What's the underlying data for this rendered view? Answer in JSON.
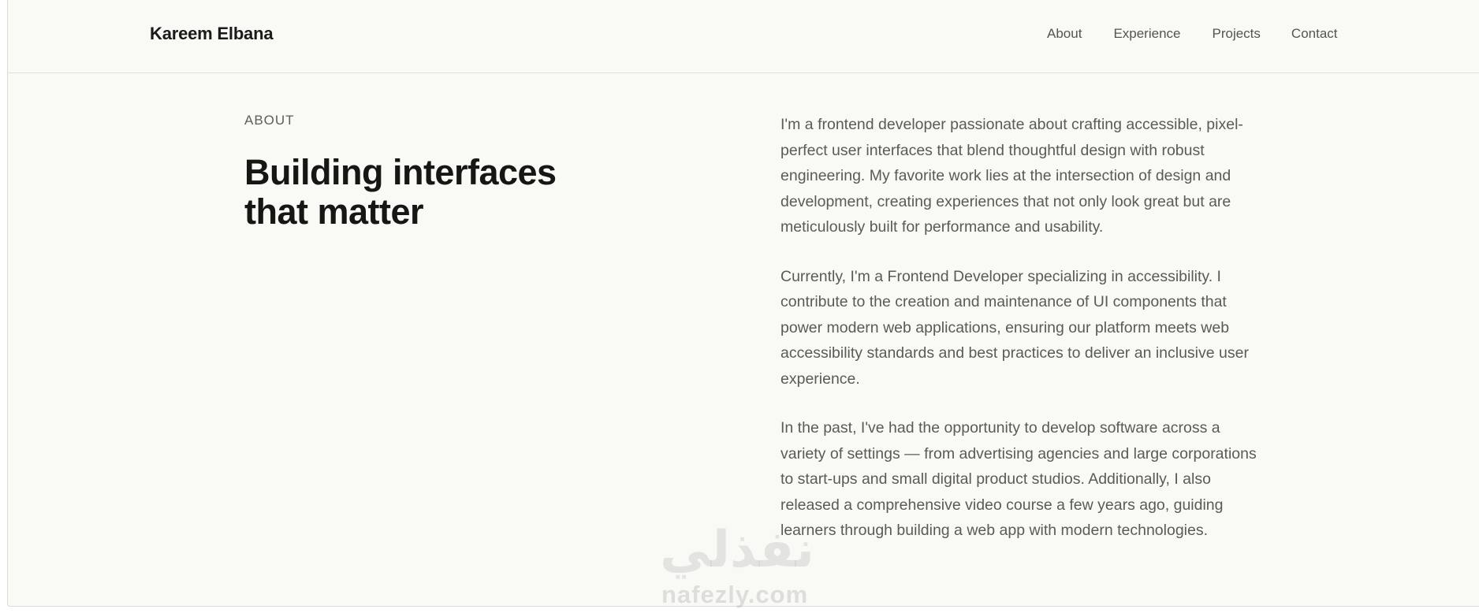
{
  "header": {
    "brand": "Kareem Elbana",
    "nav": [
      "About",
      "Experience",
      "Projects",
      "Contact"
    ]
  },
  "about": {
    "eyebrow": "ABOUT",
    "headline_line1": "Building interfaces",
    "headline_line2": "that matter",
    "paragraphs": [
      "I'm a frontend developer passionate about crafting accessible, pixel-perfect user interfaces that blend thoughtful design with robust engineering. My favorite work lies at the intersection of design and development, creating experiences that not only look great but are meticulously built for performance and usability.",
      "Currently, I'm a Frontend Developer specializing in accessibility. I contribute to the creation and maintenance of UI components that power modern web applications, ensuring our platform meets web accessibility standards and best practices to deliver an inclusive user experience.",
      "In the past, I've had the opportunity to develop software across a variety of settings — from advertising agencies and large corporations to start-ups and small digital product studios. Additionally, I also released a comprehensive video course a few years ago, guiding learners through building a web app with modern technologies."
    ]
  },
  "watermark": {
    "arabic": "نفذلي",
    "latin": "nafezly.com"
  }
}
